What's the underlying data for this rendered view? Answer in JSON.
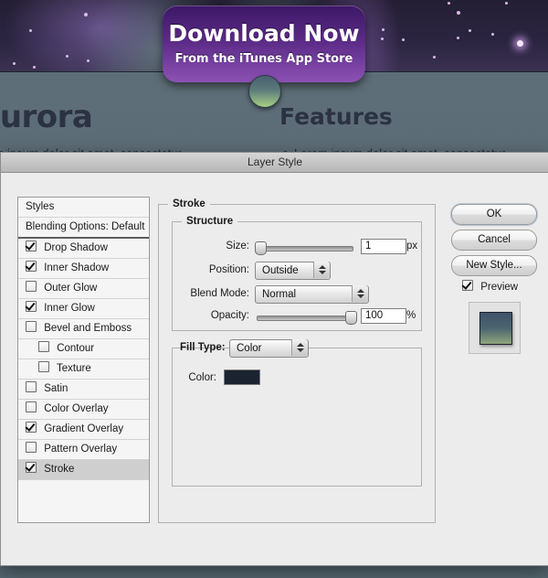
{
  "background_page": {
    "heading_left": "Aurora",
    "heading_right": "Features",
    "paragraph_left": "rem ipsum dolor sit amet, consectetur",
    "paragraph_right": "Lorem ipsum dolor sit amet, consectetur",
    "download_button": {
      "title": "Download Now",
      "subtitle": "From the iTunes App Store"
    },
    "colors": {
      "aurora_dark": "#241f33",
      "body": "#5e6e78",
      "heading": "#2b3242",
      "button_top": "#3d1866",
      "button_bottom": "#8c51b4",
      "orb_bottom": "#a8cf84"
    }
  },
  "dialog": {
    "title": "Layer Style",
    "styles_list": [
      {
        "label": "Styles",
        "checkbox": false,
        "checked": false,
        "indent": false,
        "selected": false
      },
      {
        "label": "Blending Options: Default",
        "checkbox": false,
        "checked": false,
        "indent": false,
        "selected": false
      },
      {
        "label": "Drop Shadow",
        "checkbox": true,
        "checked": true,
        "indent": false,
        "selected": false
      },
      {
        "label": "Inner Shadow",
        "checkbox": true,
        "checked": true,
        "indent": false,
        "selected": false
      },
      {
        "label": "Outer Glow",
        "checkbox": true,
        "checked": false,
        "indent": false,
        "selected": false
      },
      {
        "label": "Inner Glow",
        "checkbox": true,
        "checked": true,
        "indent": false,
        "selected": false
      },
      {
        "label": "Bevel and Emboss",
        "checkbox": true,
        "checked": false,
        "indent": false,
        "selected": false
      },
      {
        "label": "Contour",
        "checkbox": true,
        "checked": false,
        "indent": true,
        "selected": false
      },
      {
        "label": "Texture",
        "checkbox": true,
        "checked": false,
        "indent": true,
        "selected": false
      },
      {
        "label": "Satin",
        "checkbox": true,
        "checked": false,
        "indent": false,
        "selected": false
      },
      {
        "label": "Color Overlay",
        "checkbox": true,
        "checked": false,
        "indent": false,
        "selected": false
      },
      {
        "label": "Gradient Overlay",
        "checkbox": true,
        "checked": true,
        "indent": false,
        "selected": false
      },
      {
        "label": "Pattern Overlay",
        "checkbox": true,
        "checked": false,
        "indent": false,
        "selected": false
      },
      {
        "label": "Stroke",
        "checkbox": true,
        "checked": true,
        "indent": false,
        "selected": true
      }
    ],
    "stroke_panel": {
      "legend": "Stroke",
      "structure": {
        "legend": "Structure",
        "size_label": "Size:",
        "size_value": "1",
        "size_unit": "px",
        "size_slider_percent": 0,
        "position_label": "Position:",
        "position_value": "Outside",
        "blend_mode_label": "Blend Mode:",
        "blend_mode_value": "Normal",
        "opacity_label": "Opacity:",
        "opacity_value": "100",
        "opacity_unit": "%",
        "opacity_slider_percent": 100
      },
      "fill": {
        "fill_type_label": "Fill Type:",
        "fill_type_value": "Color",
        "color_label": "Color:",
        "color_value": "#1b2230"
      }
    },
    "buttons": {
      "ok": "OK",
      "cancel": "Cancel",
      "new_style": "New Style...",
      "preview_label": "Preview",
      "preview_checked": true
    }
  }
}
